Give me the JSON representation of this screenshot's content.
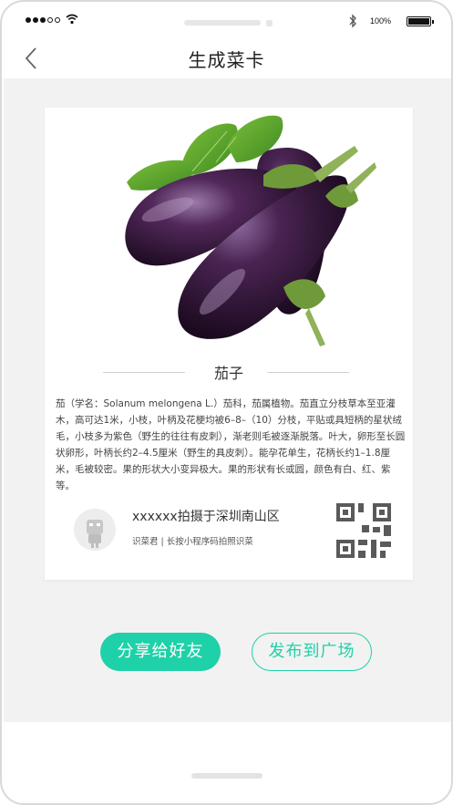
{
  "status_bar": {
    "battery_pct": "100%",
    "icons": [
      "signal-dots-icon",
      "wifi-icon",
      "bluetooth-icon",
      "battery-icon"
    ]
  },
  "nav": {
    "title": "生成菜卡",
    "back_icon": "chevron-left-icon"
  },
  "card": {
    "photo_subject": "eggplant-photo",
    "name": "茄子",
    "description": "茄（学名：Solanum melongena L.）茄科，茄属植物。茄直立分枝草本至亚灌木，高可达1米，小枝，叶柄及花梗均被6–8–（10）分枝，平贴或具短柄的星状绒毛，小枝多为紫色（野生的往往有皮刺），渐老则毛被逐渐脱落。叶大，卵形至长圆状卵形，叶柄长约2–4.5厘米（野生的具皮刺）。能孕花单生，花柄长约1–1.8厘米，毛被较密。果的形状大小变异极大。果的形状有长或圆，颜色有白、红、紫等。",
    "author_title": "xxxxxx拍摄于深圳南山区",
    "author_sub": "识菜君 | 长按小程序码拍照识菜"
  },
  "actions": {
    "share_label": "分享给好友",
    "publish_label": "发布到广场"
  },
  "colors": {
    "accent": "#1fd1a8",
    "background": "#f2f2f2",
    "card": "#ffffff"
  }
}
